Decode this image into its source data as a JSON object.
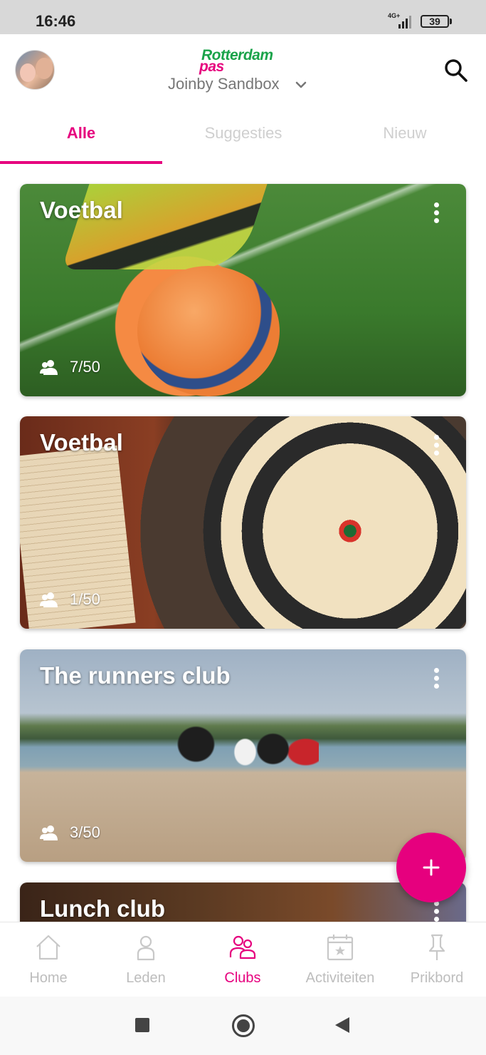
{
  "status_bar": {
    "time": "16:46",
    "network": "4G+",
    "battery": "39"
  },
  "header": {
    "logo_line1": "Rotterdam",
    "logo_line2": "pas",
    "org_name": "Joinby Sandbox",
    "icons": {
      "avatar": "user-avatar",
      "chevron": "chevron-down-icon",
      "search": "search-icon"
    }
  },
  "tabs": [
    {
      "label": "Alle",
      "active": true
    },
    {
      "label": "Suggesties",
      "active": false
    },
    {
      "label": "Nieuw",
      "active": false
    }
  ],
  "clubs": [
    {
      "title": "Voetbal",
      "members": "7/50"
    },
    {
      "title": "Voetbal",
      "members": "1/50"
    },
    {
      "title": "The runners club",
      "members": "3/50"
    },
    {
      "title": "Lunch club",
      "members": ""
    }
  ],
  "bottom_nav": [
    {
      "label": "Home",
      "icon": "home-icon",
      "active": false
    },
    {
      "label": "Leden",
      "icon": "person-icon",
      "active": false
    },
    {
      "label": "Clubs",
      "icon": "group-icon",
      "active": true
    },
    {
      "label": "Activiteiten",
      "icon": "calendar-icon",
      "active": false
    },
    {
      "label": "Prikbord",
      "icon": "pin-icon",
      "active": false
    }
  ],
  "colors": {
    "accent": "#e6007e",
    "logo_green": "#1aa34a",
    "inactive": "#bdbdbd"
  }
}
